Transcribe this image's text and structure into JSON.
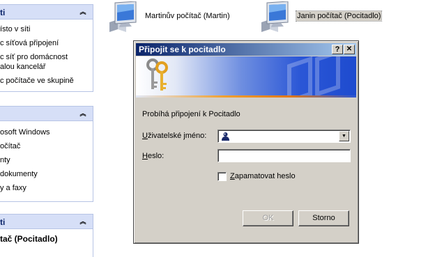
{
  "colors": {
    "titlebar_start": "#0a246a",
    "titlebar_end": "#a6caf0",
    "pane_header": "#d6dff7",
    "dialog_face": "#d4d0c8"
  },
  "pane1": {
    "title": "ti",
    "items": [
      "ísto v síti",
      "c síťová připojení",
      "c síť pro domácnost",
      "alou kancelář",
      "c počítače ve skupině"
    ]
  },
  "pane2": {
    "title": "",
    "items": [
      "osoft Windows",
      "očítač",
      "nty",
      "dokumenty",
      "y a faxy"
    ]
  },
  "pane3": {
    "title": "ti",
    "subtitle": "tač (Pocitadlo)"
  },
  "computers": [
    {
      "label": "Martinův počítač (Martin)",
      "icon": "computer-icon"
    },
    {
      "label": "Janin počítač (Pocitadlo)",
      "icon": "computer-icon"
    }
  ],
  "dialog": {
    "title": "Připojit se k pocitadlo",
    "help_glyph": "?",
    "close_glyph": "✕",
    "connecting_text": "Probíhá připojení k Pocitadlo",
    "username_label_pre": "",
    "username_label_u": "U",
    "username_label_post": "živatelské jméno:",
    "username_value": "",
    "password_label_pre": "",
    "password_label_u": "H",
    "password_label_post": "eslo:",
    "password_value": "",
    "remember_label_pre": "",
    "remember_label_u": "Z",
    "remember_label_post": "apamatovat heslo",
    "remember_checked": false,
    "ok_label": "OK",
    "cancel_label": "Storno"
  }
}
